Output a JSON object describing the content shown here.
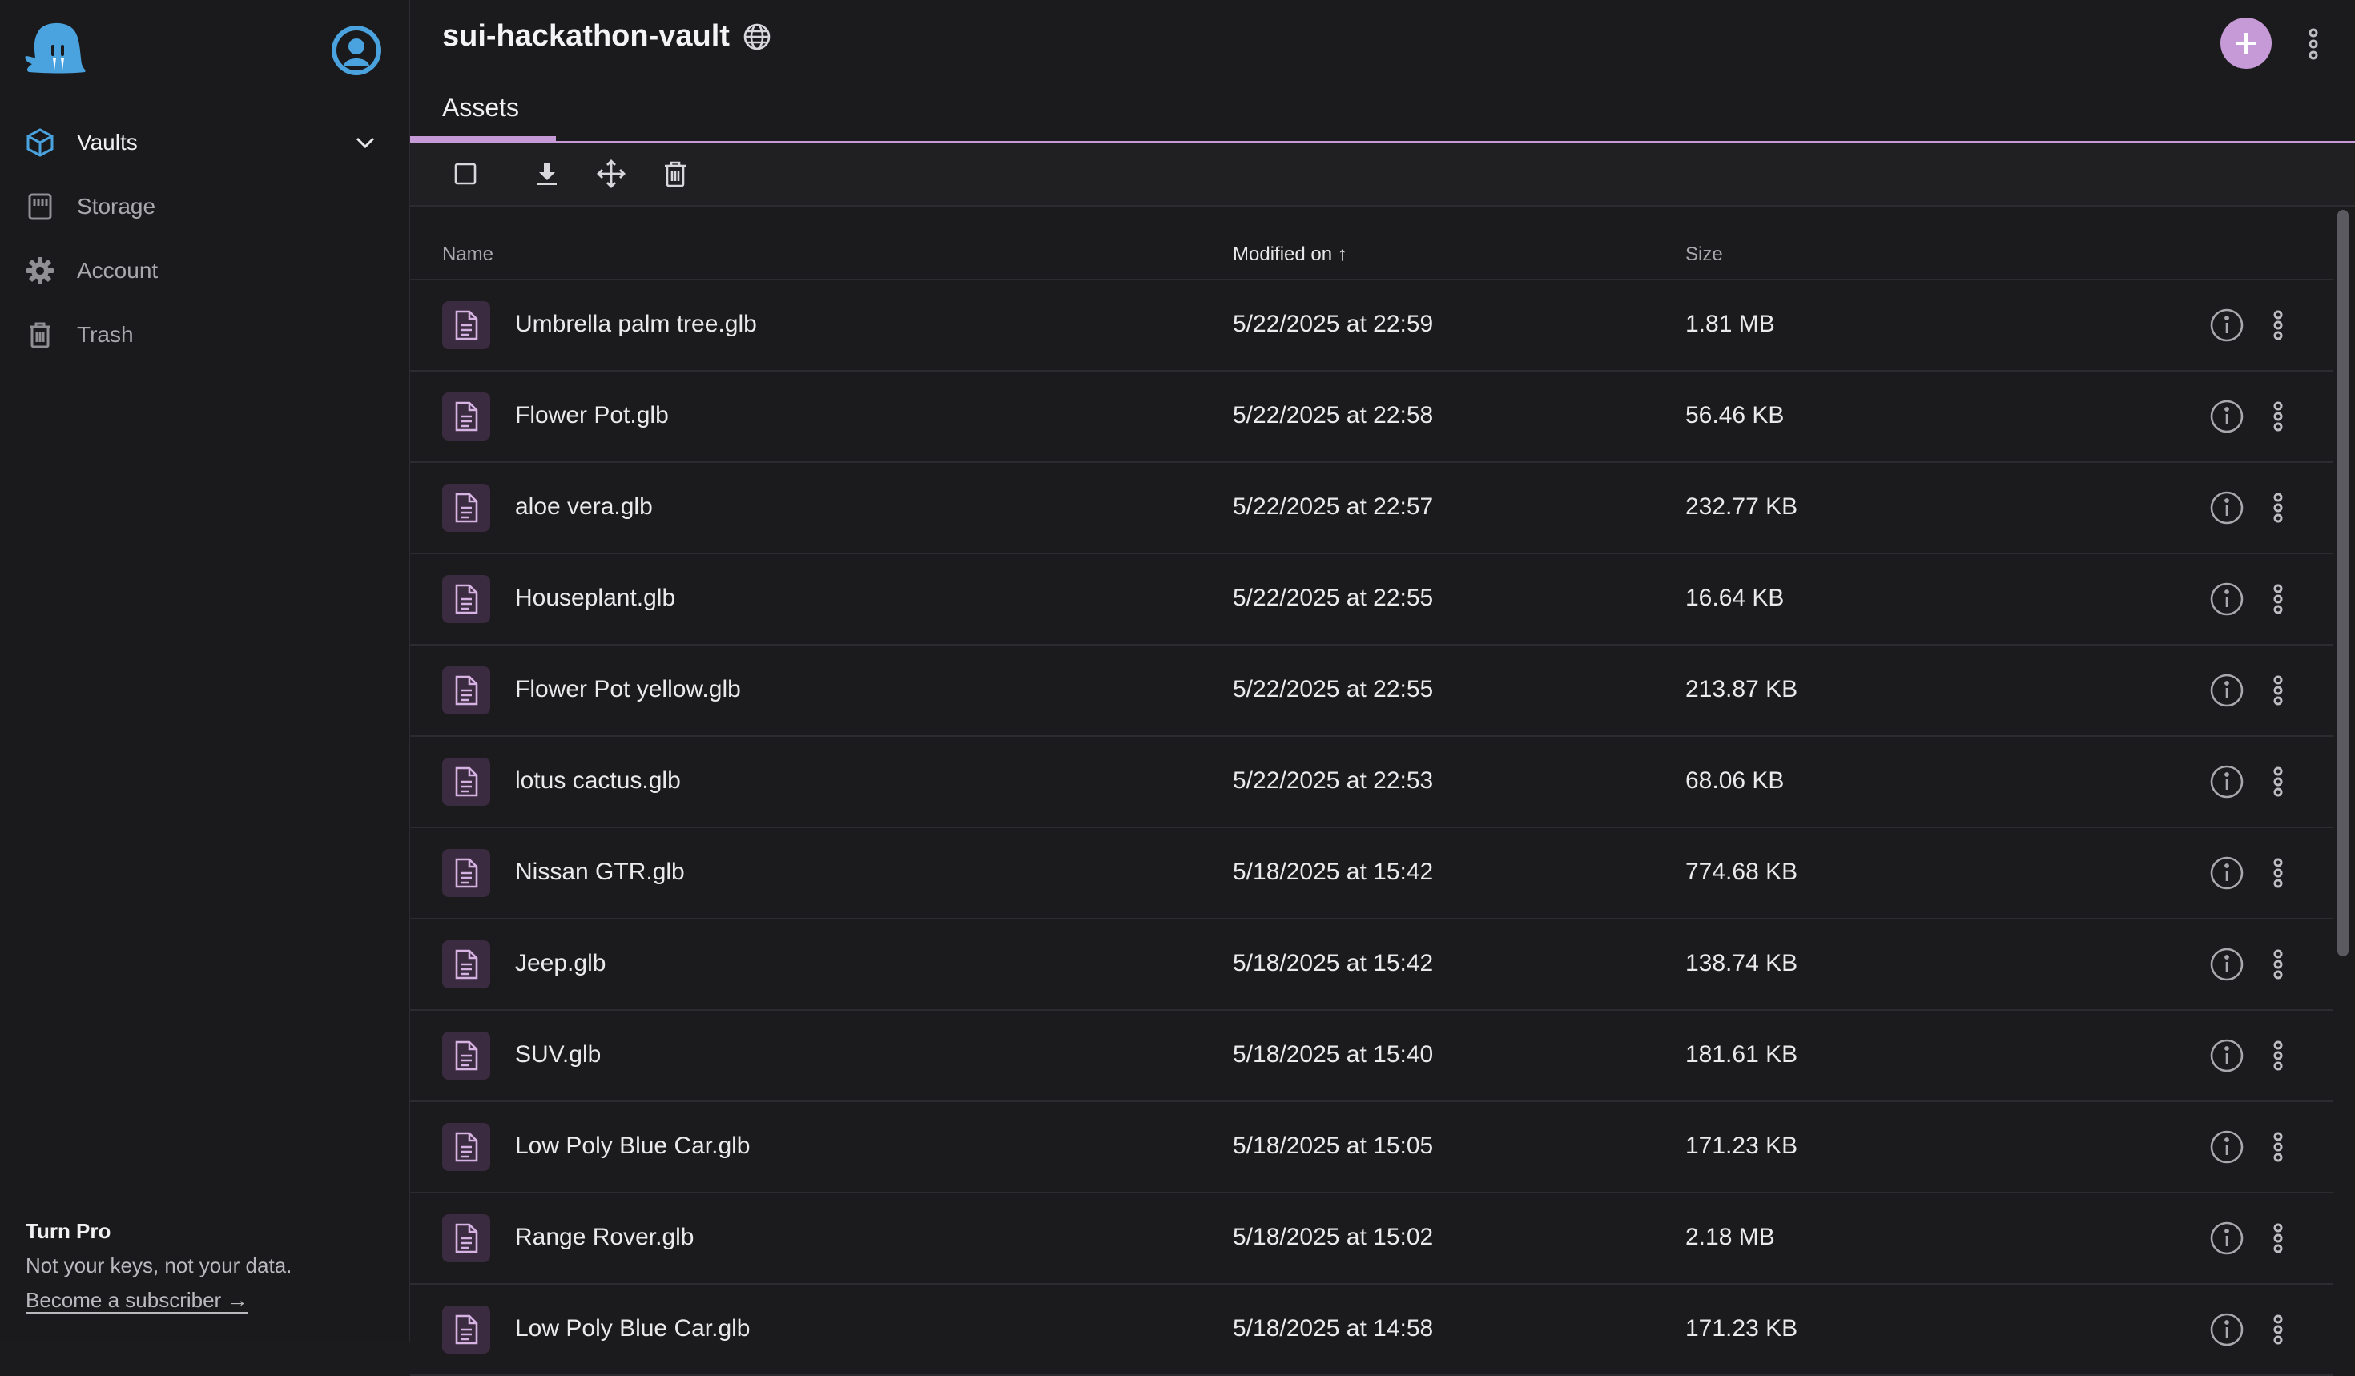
{
  "sidebar": {
    "nav": [
      {
        "label": "Vaults",
        "icon": "cube-icon"
      },
      {
        "label": "Storage",
        "icon": "storage-icon"
      },
      {
        "label": "Account",
        "icon": "gear-icon"
      },
      {
        "label": "Trash",
        "icon": "trash-icon"
      }
    ],
    "promo": {
      "title": "Turn Pro",
      "text": "Not your keys, not your data.",
      "link": "Become a subscriber →"
    }
  },
  "header": {
    "title": "sui-hackathon-vault",
    "tab": "Assets"
  },
  "table": {
    "columns": {
      "name": "Name",
      "modified": "Modified on ↑",
      "size": "Size"
    },
    "rows": [
      {
        "name": "Umbrella palm tree.glb",
        "modified": "5/22/2025 at 22:59",
        "size": "1.81 MB"
      },
      {
        "name": "Flower Pot.glb",
        "modified": "5/22/2025 at 22:58",
        "size": "56.46 KB"
      },
      {
        "name": "aloe vera.glb",
        "modified": "5/22/2025 at 22:57",
        "size": "232.77 KB"
      },
      {
        "name": "Houseplant.glb",
        "modified": "5/22/2025 at 22:55",
        "size": "16.64 KB"
      },
      {
        "name": "Flower Pot yellow.glb",
        "modified": "5/22/2025 at 22:55",
        "size": "213.87 KB"
      },
      {
        "name": "lotus cactus.glb",
        "modified": "5/22/2025 at 22:53",
        "size": "68.06 KB"
      },
      {
        "name": "Nissan GTR.glb",
        "modified": "5/18/2025 at 15:42",
        "size": "774.68 KB"
      },
      {
        "name": "Jeep.glb",
        "modified": "5/18/2025 at 15:42",
        "size": "138.74 KB"
      },
      {
        "name": "SUV.glb",
        "modified": "5/18/2025 at 15:40",
        "size": "181.61 KB"
      },
      {
        "name": "Low Poly Blue Car.glb",
        "modified": "5/18/2025 at 15:05",
        "size": "171.23 KB"
      },
      {
        "name": "Range Rover.glb",
        "modified": "5/18/2025 at 15:02",
        "size": "2.18 MB"
      },
      {
        "name": "Low Poly Blue Car.glb",
        "modified": "5/18/2025 at 14:58",
        "size": "171.23 KB"
      }
    ]
  },
  "colors": {
    "accent": "#c59ad6",
    "background": "#1b1b1d",
    "brand_blue": "#4aa3df"
  }
}
